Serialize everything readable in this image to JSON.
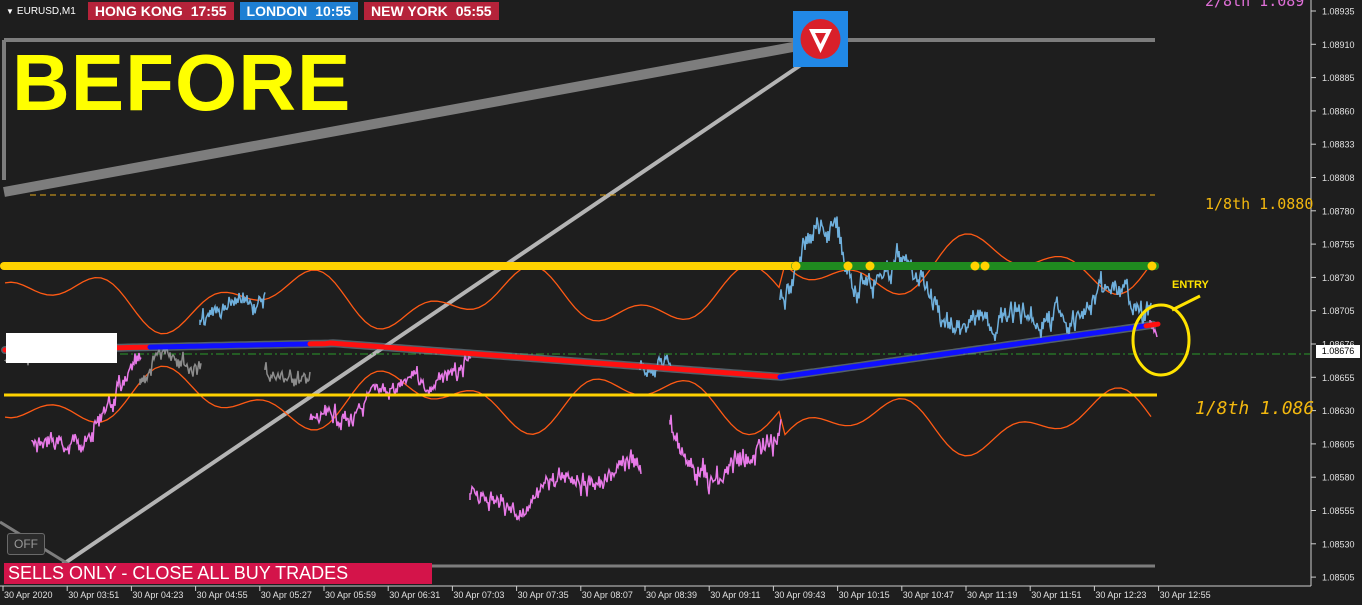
{
  "header": {
    "symbol": "EURUSD,M1",
    "clocks": [
      {
        "city": "HONG KONG",
        "time": "17:55",
        "color": "#b5233a"
      },
      {
        "city": "LONDON",
        "time": "10:55",
        "color": "#1e7fd3"
      },
      {
        "city": "NEW YORK",
        "time": "05:55",
        "color": "#b5233a"
      }
    ]
  },
  "title": "BEFORE",
  "off_button": "OFF",
  "banner": "SELLS ONLY - CLOSE ALL BUY TRADES",
  "entry_label": "ENTRY",
  "levels": {
    "top_label": "2/8th  1.089",
    "upper_label": "1/8th  1.0880",
    "lower_label": "1/8th  1.086"
  },
  "price_axis": {
    "ticks": [
      "1.08935",
      "1.08910",
      "1.08885",
      "1.08860",
      "1.08833",
      "1.08808",
      "1.08780",
      "1.08755",
      "1.08730",
      "1.08705",
      "1.08676",
      "1.08655",
      "1.08630",
      "1.08605",
      "1.08580",
      "1.08555",
      "1.08530",
      "1.08505"
    ],
    "current_price": "1.08676"
  },
  "time_axis": [
    "30 Apr 2020",
    "30 Apr 03:51",
    "30 Apr 04:23",
    "30 Apr 04:55",
    "30 Apr 05:27",
    "30 Apr 05:59",
    "30 Apr 06:31",
    "30 Apr 07:03",
    "30 Apr 07:35",
    "30 Apr 08:07",
    "30 Apr 08:39",
    "30 Apr 09:11",
    "30 Apr 09:43",
    "30 Apr 10:15",
    "30 Apr 10:47",
    "30 Apr 11:19",
    "30 Apr 11:51",
    "30 Apr 12:23",
    "30 Apr 12:55"
  ],
  "colors": {
    "background": "#1e1e1e",
    "level_yellow": "#ffd200",
    "level_green": "#1f8a1f",
    "price_blue": "#6fb0dd",
    "price_pink": "#e87ae8",
    "price_gray": "#8c8c8c",
    "band_orange": "#ff5a14",
    "ma_blue": "#1010ff",
    "ma_red": "#ff1010",
    "entry_circle": "#ffe300"
  },
  "icons": {
    "logo": "red-triangle-logo-icon",
    "dropdown": "triangle-down-icon"
  }
}
